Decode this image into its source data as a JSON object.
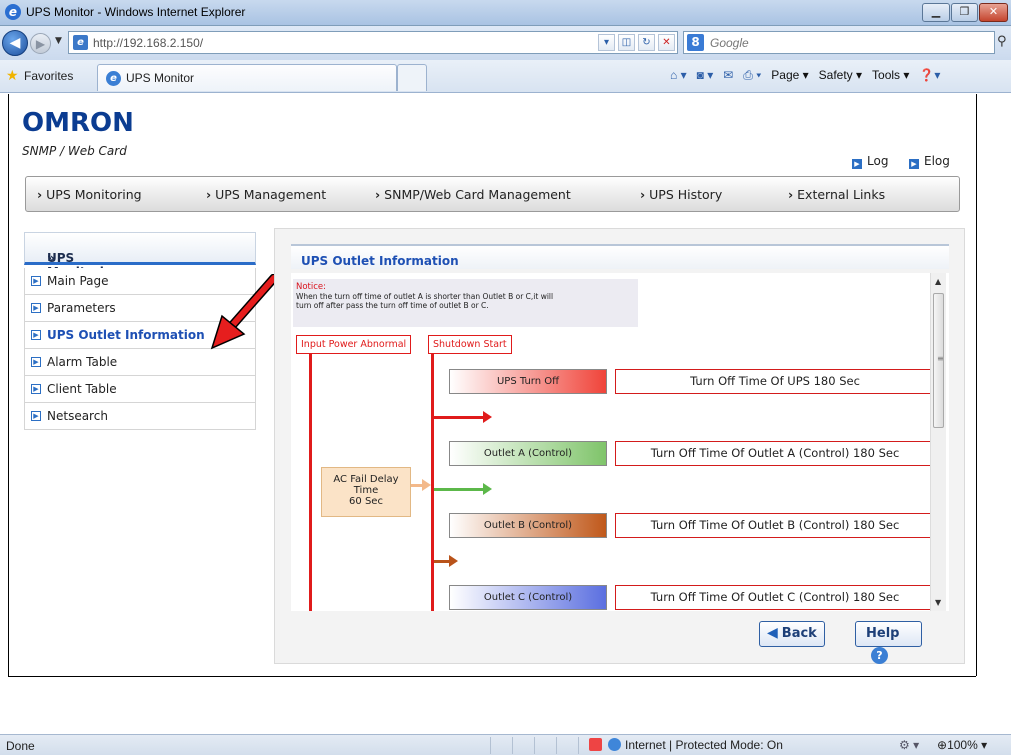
{
  "browser": {
    "window_title": "UPS Monitor - Windows Internet Explorer",
    "url": "http://192.168.2.150/",
    "search_placeholder": "Google",
    "favorites_label": "Favorites",
    "tab_title": "UPS Monitor",
    "commands": [
      "Page ▾",
      "Safety ▾",
      "Tools ▾"
    ],
    "status_left": "Done",
    "status_zone": "Internet | Protected Mode: On",
    "zoom": "100%"
  },
  "header": {
    "brand": "OMRON",
    "subtitle": "SNMP / Web Card",
    "links": [
      "Log",
      "Elog"
    ]
  },
  "main_nav": [
    "UPS Monitoring",
    "UPS Management",
    "SNMP/Web Card Management",
    "UPS History",
    "External Links"
  ],
  "sidebar": {
    "title": "UPS Monitoring",
    "items": [
      "Main Page",
      "Parameters",
      "UPS Outlet Information",
      "Alarm Table",
      "Client Table",
      "Netsearch"
    ],
    "active": "UPS Outlet Information"
  },
  "panel": {
    "title": "UPS Outlet Information",
    "notice_head": "Notice:",
    "notice_line1": "When the turn off time of outlet A is shorter than Outlet B or C,it will",
    "notice_line2": "turn off after pass the turn off time of outlet B or C.",
    "trigger_input": "Input Power Abnormal",
    "trigger_shutdown": "Shutdown Start",
    "ac_delay_line1": "AC Fail Delay",
    "ac_delay_line2": "Time",
    "ac_delay_line3": "60 Sec",
    "stages": [
      {
        "label": "UPS Turn Off",
        "desc": "Turn Off Time Of UPS 180 Sec",
        "color": "#f0443a"
      },
      {
        "label": "Outlet A (Control)",
        "desc": "Turn Off Time Of Outlet A (Control) 180 Sec",
        "color": "#7fc46a"
      },
      {
        "label": "Outlet B (Control)",
        "desc": "Turn Off Time Of Outlet B (Control) 180 Sec",
        "color": "#c0581a"
      },
      {
        "label": "Outlet C (Control)",
        "desc": "Turn Off Time Of Outlet C (Control) 180 Sec",
        "color": "#5b6fe0"
      }
    ],
    "back_label": "Back",
    "help_label": "Help"
  }
}
